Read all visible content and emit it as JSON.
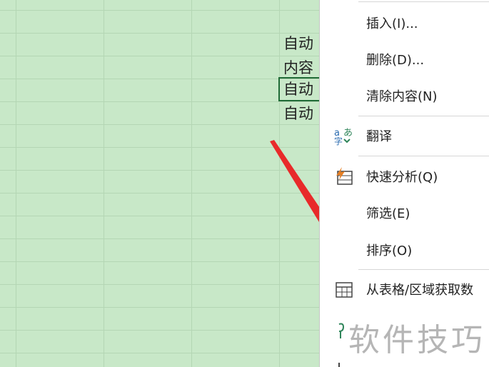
{
  "sheet": {
    "cells": [
      "自动",
      "内容",
      "自动",
      "自动"
    ]
  },
  "context_menu": {
    "items": [
      {
        "label": "插入(I)..."
      },
      {
        "label": "删除(D)..."
      },
      {
        "label": "清除内容(N)"
      },
      {
        "label": "翻译"
      },
      {
        "label": "快速分析(Q)"
      },
      {
        "label": "筛选(E)"
      },
      {
        "label": "排序(O)"
      },
      {
        "label": "从表格/区域获取数"
      }
    ]
  },
  "watermark": "软件技巧",
  "colors": {
    "sheet_bg": "#c8e8c8",
    "active_cell_border": "#1f6b36",
    "annotation_arrow": "#e82a2a"
  }
}
